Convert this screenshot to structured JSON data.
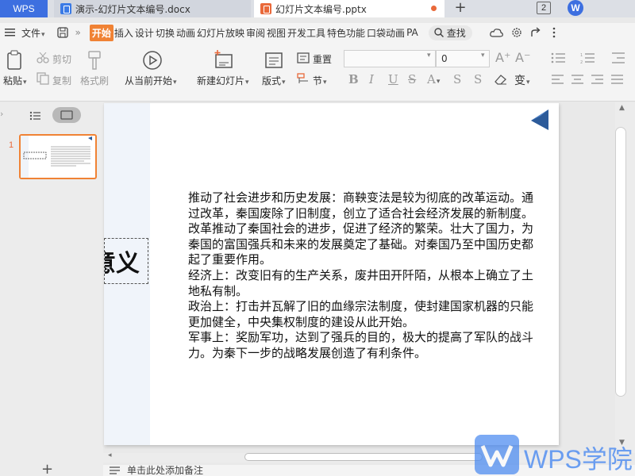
{
  "titlebar": {
    "app_tab": "WPS",
    "doc_tab": "演示-幻灯片文本编号.docx",
    "ppt_tab": "幻灯片文本编号.pptx",
    "new_tab_symbol": "+",
    "window_badge": "2",
    "account_initial": "W"
  },
  "menu": {
    "file": "文件",
    "more": "»",
    "tabs": [
      "开始",
      "插入",
      "设计",
      "切换",
      "动画",
      "幻灯片放映",
      "审阅",
      "视图",
      "开发工具",
      "特色功能",
      "口袋动画",
      "PA"
    ],
    "search": "查找"
  },
  "ribbon": {
    "paste": "粘贴",
    "cut": "剪切",
    "copy": "复制",
    "format_painter": "格式刷",
    "play_from_current": "从当前开始",
    "new_slide": "新建幻灯片",
    "layout": "版式",
    "reset": "重置",
    "section": "节",
    "font_name": "",
    "font_size": "0",
    "grow_font": "A⁺",
    "shrink_font": "A⁻",
    "bold": "B",
    "italic": "I",
    "underline": "U",
    "strike": "S",
    "font_color": "A",
    "shadow": "S",
    "phonetic": "变",
    "clear": "A"
  },
  "thumbnail": {
    "number": "1"
  },
  "slide": {
    "title": "意义",
    "paragraphs": [
      "推动了社会进步和历史发展：商鞅变法是较为彻底的改革运动。通过改革，秦国废除了旧制度，创立了适合社会经济发展的新制度。改革推动了秦国社会的进步，促进了经济的繁荣。壮大了国力，为秦国的富国强兵和未来的发展奠定了基础。对秦国乃至中国历史都起了重要作用。",
      "经济上：改变旧有的生产关系，废井田开阡陌，从根本上确立了土地私有制。",
      "政治上：打击并瓦解了旧的血缘宗法制度，使封建国家机器的只能更加健全，中央集权制度的建设从此开始。",
      "军事上：奖励军功，达到了强兵的目的，极大的提高了军队的战斗力。为秦下一步的战略发展创造了有利条件。"
    ]
  },
  "notes": {
    "placeholder": "单击此处添加备注"
  },
  "watermark": {
    "text": "WPS学院"
  },
  "colors": {
    "accent": "#f08234",
    "brand": "#3d6fe0",
    "watermark": "#4a8af1"
  }
}
